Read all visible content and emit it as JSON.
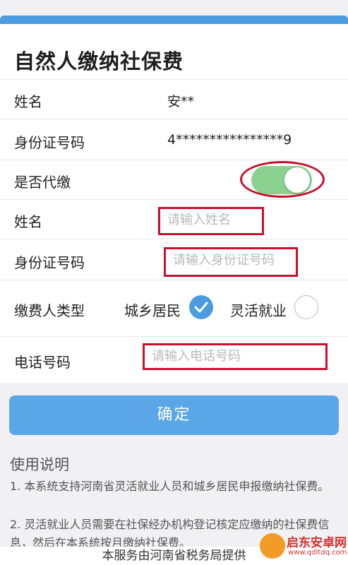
{
  "page": {
    "title": "自然人缴纳社保费"
  },
  "form": {
    "name_label": "姓名",
    "name_value": "安**",
    "id_label": "身份证号码",
    "id_value": "4****************9",
    "proxy_label": "是否代缴",
    "proxy_on": true,
    "proxy_name_label": "姓名",
    "proxy_name_placeholder": "请输入姓名",
    "proxy_id_label": "身份证号码",
    "proxy_id_placeholder": "请输入身份证号码",
    "payer_type_label": "缴费人类型",
    "payer_type_options": [
      {
        "label": "城乡居民",
        "selected": true
      },
      {
        "label": "灵活就业",
        "selected": false
      }
    ],
    "phone_label": "电话号码",
    "phone_placeholder": "请输入电话号码"
  },
  "confirm_label": "确定",
  "help": {
    "title": "使用说明",
    "line1": "1. 本系统支持河南省灵活就业人员和城乡居民申报缴纳社保费。",
    "line2": "2. 灵活就业人员需要在社保经办机构登记核定应缴纳的社保费信息，然后在本系统按月缴纳社保费。"
  },
  "footer": "本服务由河南省税务局提供",
  "watermark": {
    "title": "启东安卓网",
    "url": "www.qdltdq.com"
  },
  "colors": {
    "accent": "#4a9be0",
    "toggle_on": "#8bd18f",
    "highlight": "#c8102e"
  }
}
